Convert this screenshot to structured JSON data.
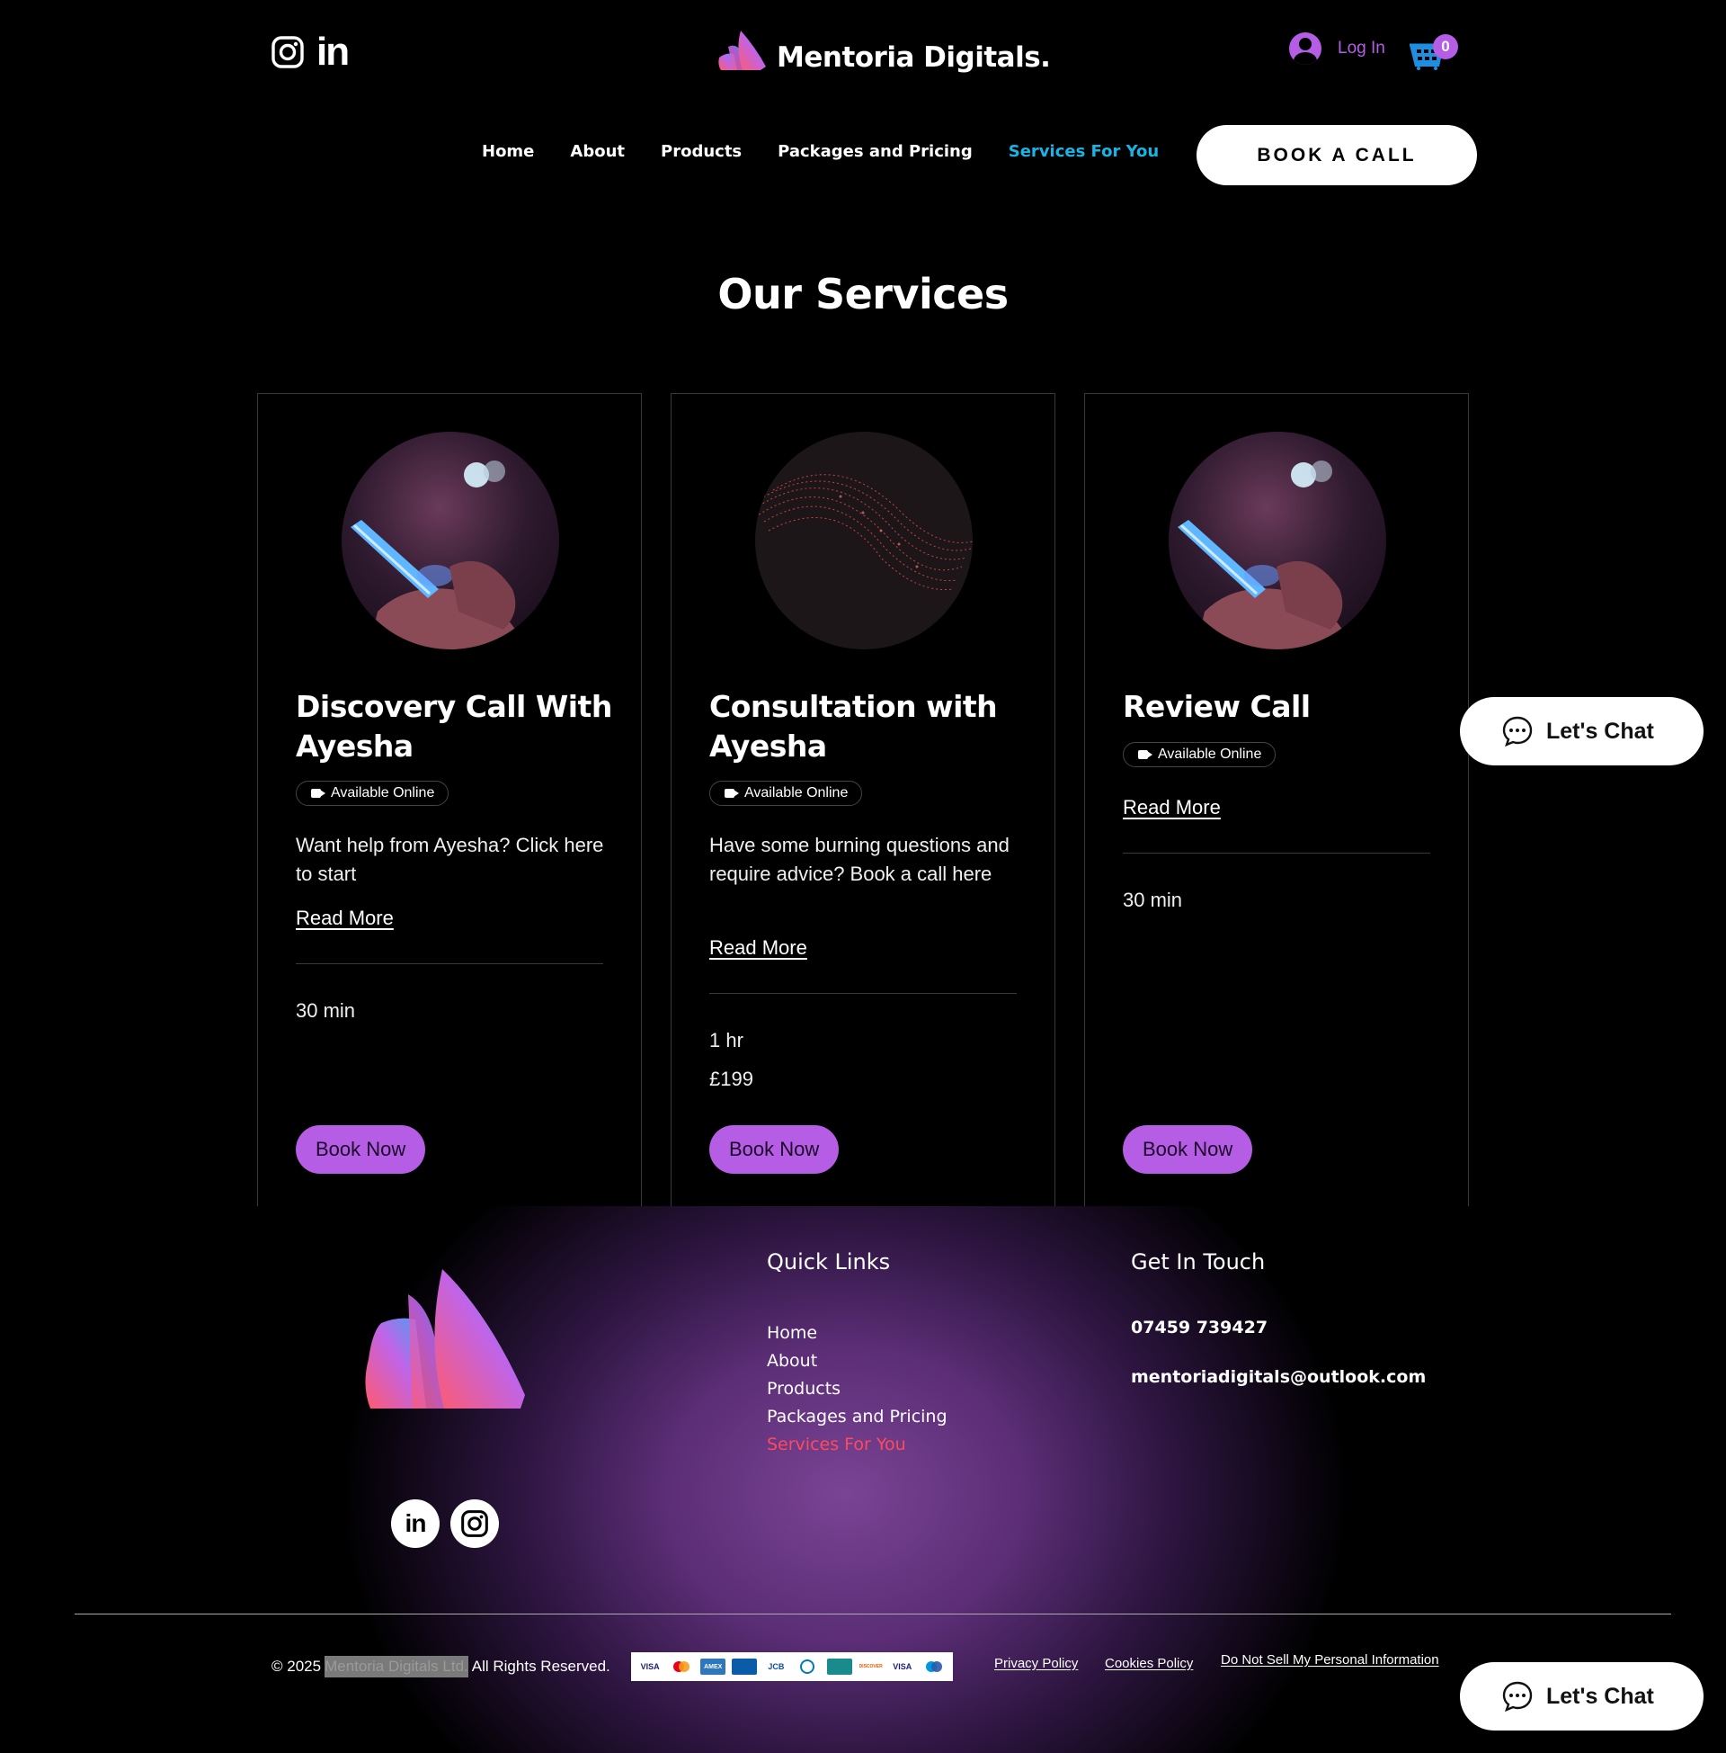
{
  "header": {
    "brand_name": "Mentoria Digitals.",
    "login_label": "Log In",
    "cart_count": "0",
    "social_linkedin_text": "in",
    "nav": [
      {
        "label": "Home"
      },
      {
        "label": "About"
      },
      {
        "label": "Products"
      },
      {
        "label": "Packages and Pricing"
      },
      {
        "label": "Services For You",
        "active": true
      }
    ],
    "book_call_label": "BOOK A CALL"
  },
  "services": {
    "title": "Our Services",
    "cards": [
      {
        "title_line1": "Discovery Call With",
        "title_line2": "Ayesha",
        "badge": "Available Online",
        "description": "Want help from Ayesha? Click here to start",
        "read_more": "Read More",
        "duration": "30 min",
        "price": "",
        "button": "Book Now",
        "image": "phone-hand-image"
      },
      {
        "title_line1": "Consultation with",
        "title_line2": "Ayesha",
        "badge": "Available Online",
        "description": "Have some burning questions and require advice? Book a call here",
        "read_more": "Read More",
        "duration": "1 hr",
        "price": "£199",
        "button": "Book Now",
        "image": "digital-wave-image"
      },
      {
        "title_line1": "Review Call",
        "title_line2": "",
        "badge": "Available Online",
        "description": "",
        "read_more": "Read More",
        "duration": "30 min",
        "price": "",
        "button": "Book Now",
        "image": "phone-hand-image"
      }
    ]
  },
  "chat": {
    "label": "Let's Chat"
  },
  "footer": {
    "social_linkedin_text": "in",
    "quick_links_heading": "Quick Links",
    "quick_links": [
      {
        "label": "Home"
      },
      {
        "label": "About"
      },
      {
        "label": "Products"
      },
      {
        "label": "Packages and Pricing"
      },
      {
        "label": "Services For You",
        "active": true
      }
    ],
    "get_in_touch_heading": "Get In Touch",
    "phone": "07459 739427",
    "email": "mentoriadigitals@outlook.com",
    "copyright_prefix": "© 2025",
    "copyright_owner": "Mentoria Digitals Ltd.",
    "copyright_suffix": "All Rights Reserved.",
    "payment_methods": [
      {
        "label": "VISA",
        "icon": "visa-icon"
      },
      {
        "label": "",
        "icon": "mastercard-icon"
      },
      {
        "label": "AMEX",
        "icon": "amex-icon"
      },
      {
        "label": "",
        "icon": "card-icon"
      },
      {
        "label": "JCB",
        "icon": "jcb-icon"
      },
      {
        "label": "",
        "icon": "diners-icon"
      },
      {
        "label": "",
        "icon": "cb-icon"
      },
      {
        "label": "DISCOVER",
        "icon": "discover-icon"
      },
      {
        "label": "VISA",
        "icon": "visa-icon"
      },
      {
        "label": "",
        "icon": "maestro-icon"
      }
    ],
    "privacy_policy": "Privacy Policy",
    "cookies_policy": "Cookies Policy",
    "do_not_sell": "Do Not Sell My Personal Information"
  },
  "colors": {
    "accent_purple": "#b65de5",
    "nav_active": "#19b4e6",
    "footer_active": "#ff4a5c",
    "background": "#000000"
  }
}
